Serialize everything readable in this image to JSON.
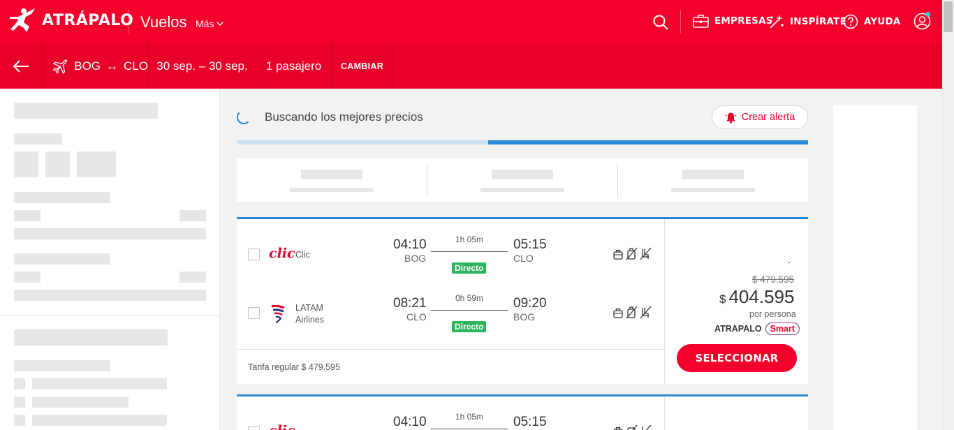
{
  "header": {
    "logo": "ATRÁPALO",
    "nav_vuelos": "Vuelos",
    "nav_mas": "Más",
    "links": {
      "empresas": "EMPRESAS",
      "inspirate": "INSPÍRATE",
      "ayuda": "AYUDA"
    }
  },
  "search_summary": {
    "origin": "BOG",
    "arrow": "↔",
    "destination": "CLO",
    "dates": "30 sep. – 30 sep.",
    "passengers": "1 pasajero",
    "change": "CAMBIAR"
  },
  "results": {
    "status": "Buscando los mejores precios",
    "alert_button": "Crear alerta",
    "progress": 0.44
  },
  "cards": [
    {
      "outbound": {
        "airline": "Clic",
        "logo_text": "clic",
        "dep_time": "04:10",
        "dep_iata": "BOG",
        "duration": "1h 05m",
        "stops": "Directo",
        "arr_time": "05:15",
        "arr_iata": "CLO"
      },
      "return": {
        "airline_line1": "LATAM",
        "airline_line2": "Airlines",
        "dep_time": "08:21",
        "dep_iata": "CLO",
        "duration": "0h 59m",
        "stops": "Directo",
        "arr_time": "09:20",
        "arr_iata": "BOG"
      },
      "tarifa": "Tarifa regular  $ 479.595",
      "old_price": "$ 479.595",
      "currency": "$",
      "price": "404.595",
      "per_person": "por persona",
      "brand": "ATRAPALO",
      "brand_tag": "Smart",
      "select": "SELECCIONAR"
    },
    {
      "outbound": {
        "dep_time": "04:10",
        "duration": "1h 05m",
        "arr_time": "05:15"
      }
    }
  ]
}
